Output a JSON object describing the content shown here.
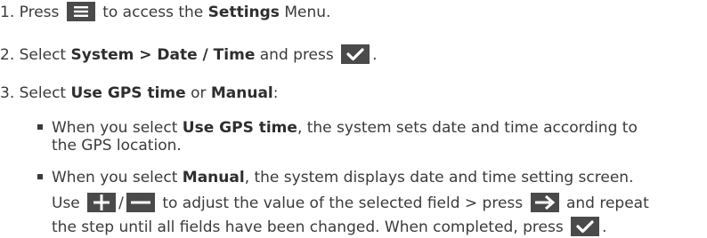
{
  "steps": [
    {
      "num": "1.",
      "press": "Press",
      "icon": "menu-icon",
      "after": "to access the",
      "bold": "Settings",
      "tail": "Menu."
    },
    {
      "num": "2.",
      "select": "Select",
      "bold": "System > Date / Time",
      "and_press": "and press",
      "icon": "check-icon",
      "tail": "."
    },
    {
      "num": "3.",
      "select": "Select",
      "bold1": "Use GPS time",
      "or": "or",
      "bold2": "Manual",
      "tail": ":"
    }
  ],
  "bullets": [
    {
      "pre": "When you select",
      "bold": "Use GPS time",
      "post_line1": ", the system sets date and time according to",
      "post_line2": "the GPS location."
    },
    {
      "pre": "When you select",
      "bold": "Manual",
      "post": ", the system displays date and time setting screen.",
      "use": "Use",
      "slash": "/",
      "adjust": "to adjust the value of the selected field > press",
      "and_repeat": "and repeat",
      "line3": "the step until all fields have been changed. When completed, press",
      "end": ".",
      "icons": [
        "plus-icon",
        "minus-icon",
        "arrow-right-icon",
        "check-icon"
      ]
    }
  ],
  "colors": {
    "icon_bg": "#4a4a4a",
    "icon_fg": "#ffffff",
    "text": "#3a3a3a"
  }
}
